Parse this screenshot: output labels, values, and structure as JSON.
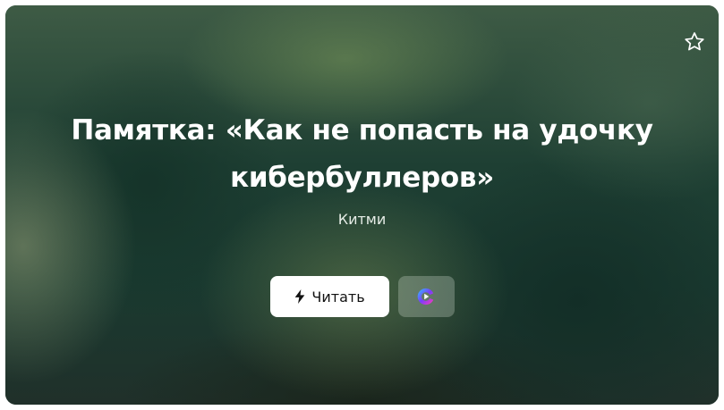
{
  "card": {
    "title": "Памятка: «Как не попасть на удочку кибербуллеров»",
    "author": "Китми",
    "favorite_icon": "star-outline-icon",
    "read_button": {
      "label": "Читать",
      "icon": "lightning-icon"
    },
    "service_button": {
      "icon": "video-play-app-icon"
    }
  },
  "colors": {
    "background_dark": "#1e3a2c",
    "button_white": "#ffffff",
    "text_white": "#ffffff"
  }
}
